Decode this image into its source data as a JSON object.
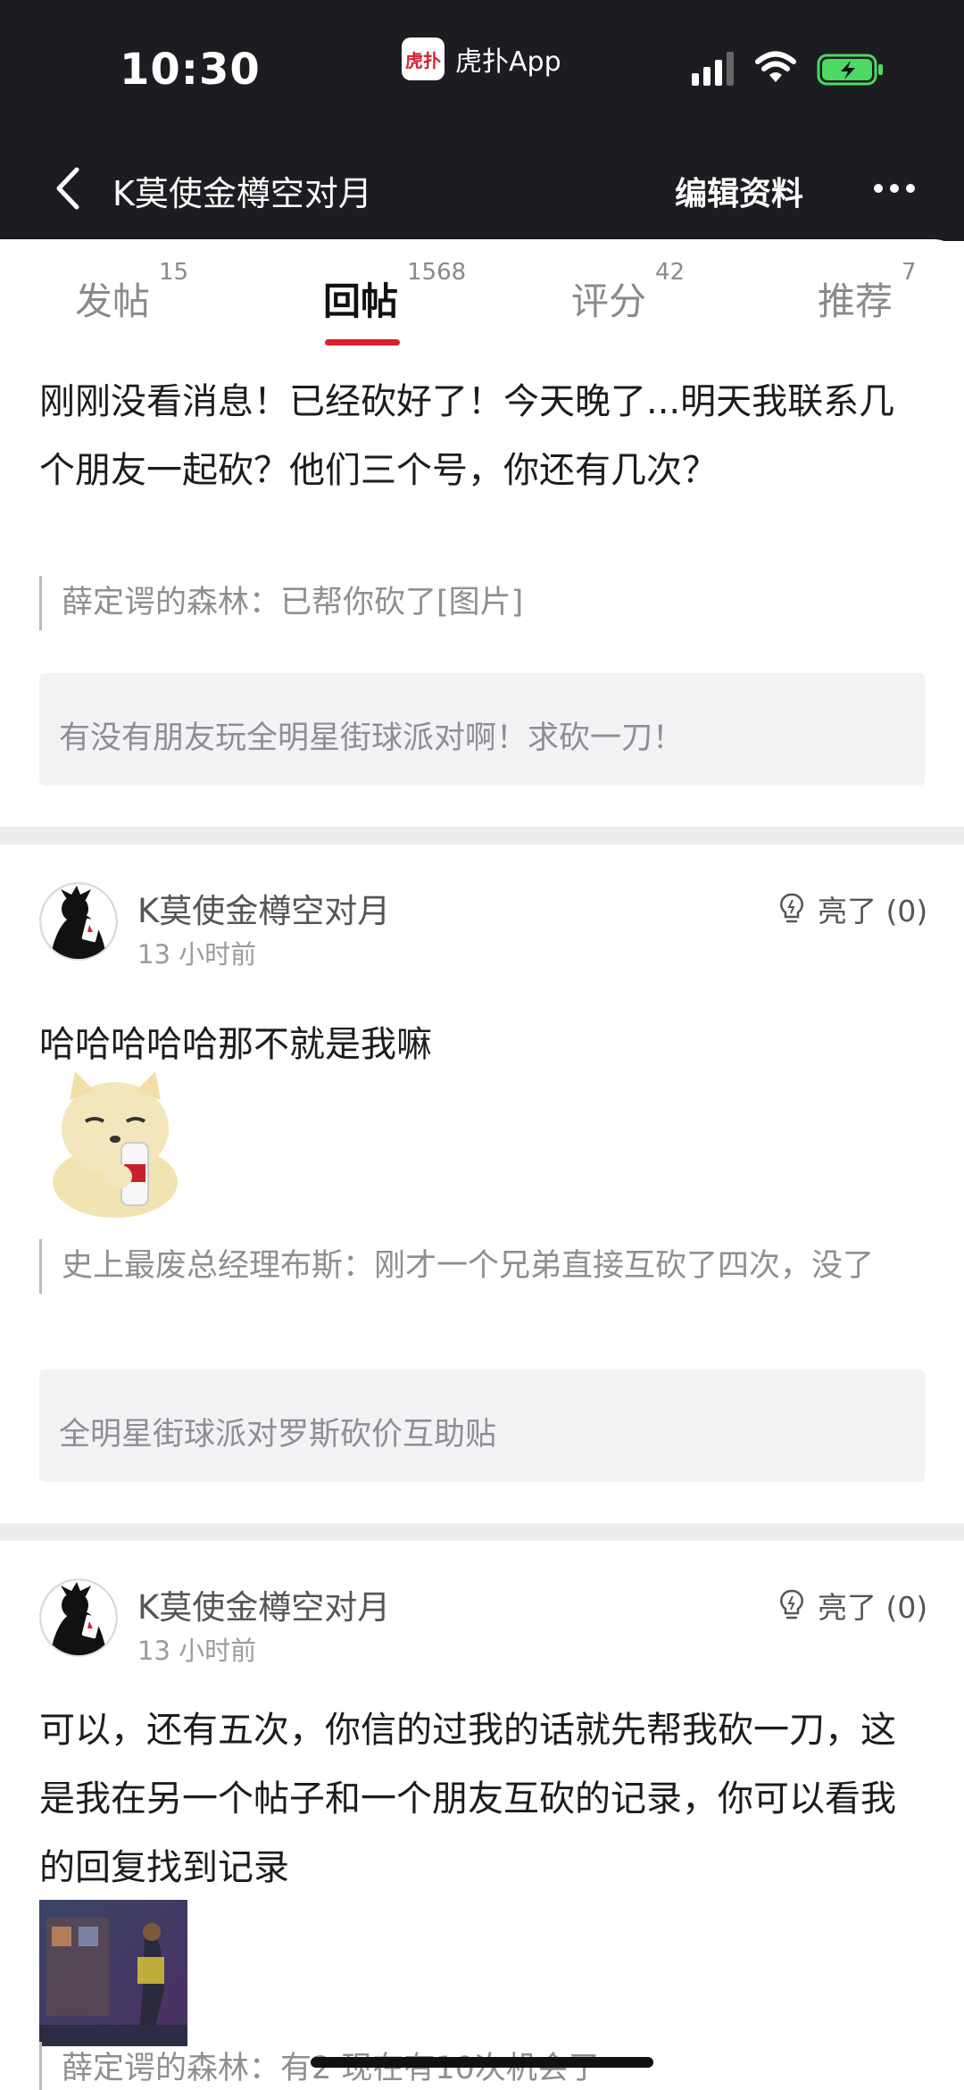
{
  "status_bar": {
    "time": "10:30",
    "app_name": "虎扑App",
    "app_logo_text": "虎扑"
  },
  "header": {
    "title": "K莫使金樽空对月",
    "edit_label": "编辑资料"
  },
  "tabs": [
    {
      "label": "发帖",
      "count": "15"
    },
    {
      "label": "回帖",
      "count": "1568"
    },
    {
      "label": "评分",
      "count": "42"
    },
    {
      "label": "推荐",
      "count": "7"
    }
  ],
  "active_tab": "回帖",
  "replies": [
    {
      "text": "刚刚没看消息！已经砍好了！今天晚了...明天我联系几个朋友一起砍？他们三个号，你还有几次？",
      "quote": "薛定谔的森林：已帮你砍了[图片]",
      "thread": "有没有朋友玩全明星街球派对啊！求砍一刀！"
    },
    {
      "author": "K莫使金樽空对月",
      "time": "13 小时前",
      "like_label": "亮了 (0)",
      "text": "哈哈哈哈哈那不就是我嘛",
      "image": "sticker",
      "quote": "史上最废总经理布斯：刚才一个兄弟直接互砍了四次，没了",
      "thread": "全明星街球派对罗斯砍价互助贴"
    },
    {
      "author": "K莫使金樽空对月",
      "time": "13 小时前",
      "like_label": "亮了 (0)",
      "text": "可以，还有五次，你信的过我的话就先帮我砍一刀，这是我在另一个帖子和一个朋友互砍的记录，你可以看我的回复找到记录",
      "image": "game-screenshot",
      "quote": "薛定谔的森林：有2 现在有10次机会了"
    }
  ],
  "colors": {
    "accent": "#d8202f",
    "header_bg": "#1c1d21",
    "divider": "#ededf0",
    "quote_box": "#f3f3f5"
  },
  "icons": [
    "back-arrow-icon",
    "more-icon",
    "lightbulb-icon",
    "signal-icon",
    "wifi-icon",
    "battery-icon"
  ]
}
